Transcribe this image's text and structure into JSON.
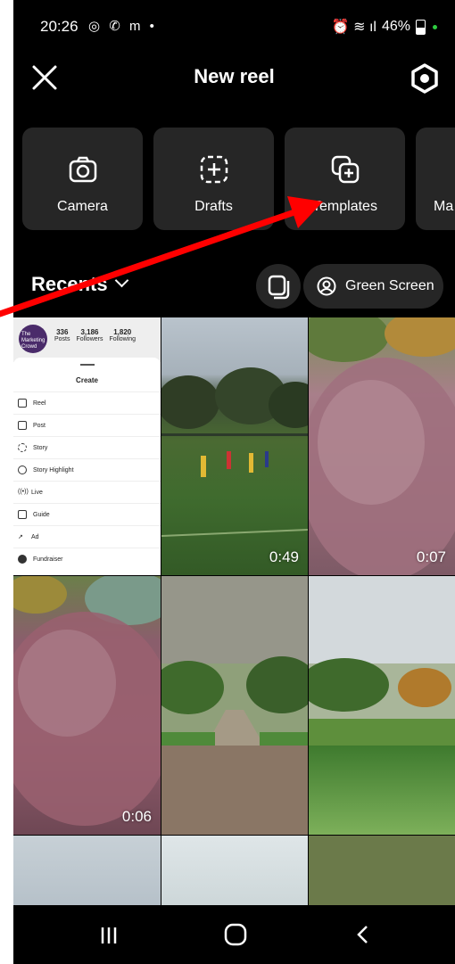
{
  "status_bar": {
    "time": "20:26",
    "left_icons": "◎ ✆ m •",
    "right_icons": "⏰ ≋ ıl",
    "battery": "46%"
  },
  "header": {
    "title": "New reel"
  },
  "tiles": [
    {
      "label": "Camera"
    },
    {
      "label": "Drafts"
    },
    {
      "label": "Templates"
    },
    {
      "label": "Ma"
    }
  ],
  "recents": {
    "label": "Recents",
    "green_screen_label": "Green Screen"
  },
  "grid": [
    {
      "type": "screenshot",
      "duration": ""
    },
    {
      "type": "video",
      "duration": "0:49"
    },
    {
      "type": "video",
      "duration": "0:07"
    },
    {
      "type": "video",
      "duration": "0:06"
    },
    {
      "type": "photo",
      "duration": ""
    },
    {
      "type": "photo",
      "duration": ""
    }
  ],
  "screenshot_thumb": {
    "avatar_text": "The Marketing Crowd",
    "stats": [
      {
        "value": "336",
        "label": "Posts"
      },
      {
        "value": "3,186",
        "label": "Followers"
      },
      {
        "value": "1,820",
        "label": "Following"
      }
    ],
    "sheet_title": "Create",
    "menu": [
      "Reel",
      "Post",
      "Story",
      "Story Highlight",
      "Live",
      "Guide",
      "Ad",
      "Fundraiser"
    ]
  },
  "colors": {
    "background": "#000000",
    "tile": "#262626",
    "arrow": "#ff0000"
  }
}
